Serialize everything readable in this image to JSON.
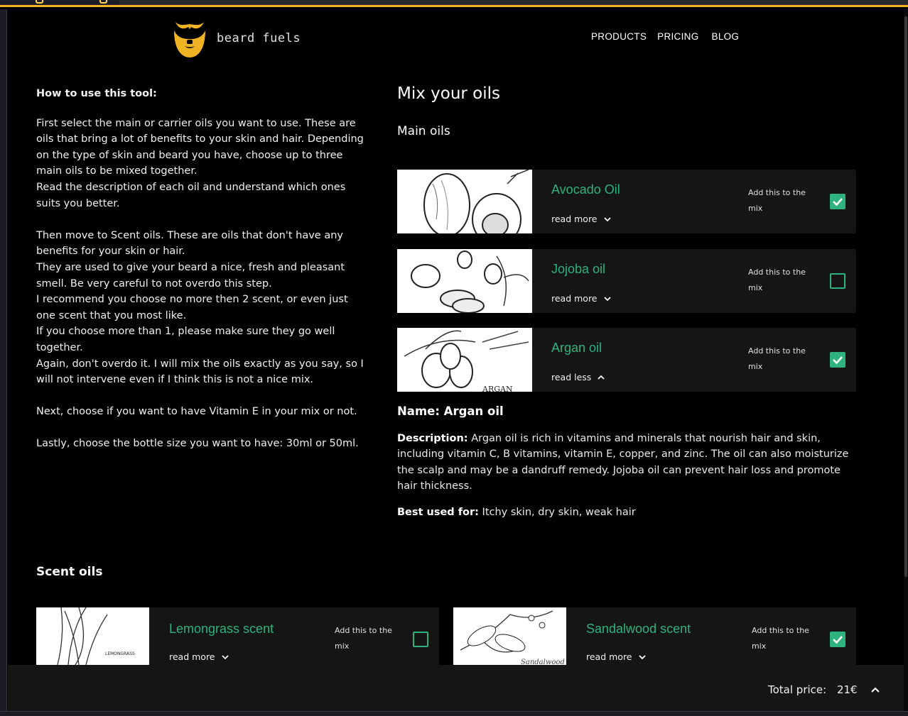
{
  "brand": {
    "name": "beard fuels",
    "accent": "#f0b323",
    "green": "#2fb37e"
  },
  "nav": {
    "products": "PRODUCTS",
    "pricing": "PRICING",
    "blog": "BLOG"
  },
  "howto": {
    "title": "How to use this tool:",
    "p1": "First select the main or carrier oils you want to use. These are oils that bring a lot of benefits to your skin and hair. Depending on the type of skin and beard you have, choose up to three main oils to be mixed together.",
    "p2": "Read the description of each oil and understand which ones suits you better.",
    "p3": "Then move to Scent oils. These are oils that don't have any benefits for your skin or hair.",
    "p4": "They are used to give your beard a nice, fresh and pleasant smell. Be very careful to not overdo this step.",
    "p5": "I recommend you choose no more then 2 scent, or even just one scent that you most like.",
    "p6": "If you choose more than 1, please make sure they go well together.",
    "p7": "Again, don't overdo it. I will mix the oils exactly as you say, so I will not intervene even if I think this is not a nice mix.",
    "p8": "Next, choose if you want to have Vitamin E in your mix or not.",
    "p9": "Lastly, choose the bottle size you want to have: 30ml or 50ml."
  },
  "mix": {
    "title": "Mix your oils",
    "main_title": "Main oils",
    "add_label": "Add this to the mix"
  },
  "main_oils": [
    {
      "name": "Avocado Oil",
      "toggle": "read more",
      "checked": true,
      "icon": "avocado-sketch"
    },
    {
      "name": "Jojoba oil",
      "toggle": "read more",
      "checked": false,
      "icon": "jojoba-sketch"
    },
    {
      "name": "Argan oil",
      "toggle": "read less",
      "checked": true,
      "icon": "argan-sketch"
    }
  ],
  "detail": {
    "name": "Name: Argan oil",
    "desc_label": "Description:",
    "desc": "Argan oil is rich in vitamins and minerals that nourish hair and skin, including vitamin C, B vitamins, vitamin E, copper, and zinc. The oil can also moisturize the scalp and may be a dandruff remedy. Jojoba oil can prevent hair loss and promote hair thickness.",
    "best_label": "Best used for:",
    "best": "Itchy skin, dry skin, weak hair"
  },
  "scent": {
    "title": "Scent oils",
    "items": [
      {
        "name": "Lemongrass scent",
        "toggle": "read more",
        "checked": false,
        "img_text": "LEMONGRASS"
      },
      {
        "name": "Sandalwood scent",
        "toggle": "read more",
        "checked": true,
        "img_text": "Sandalwood"
      }
    ]
  },
  "footer": {
    "total_label": "Total price:",
    "total_value": "21€"
  }
}
